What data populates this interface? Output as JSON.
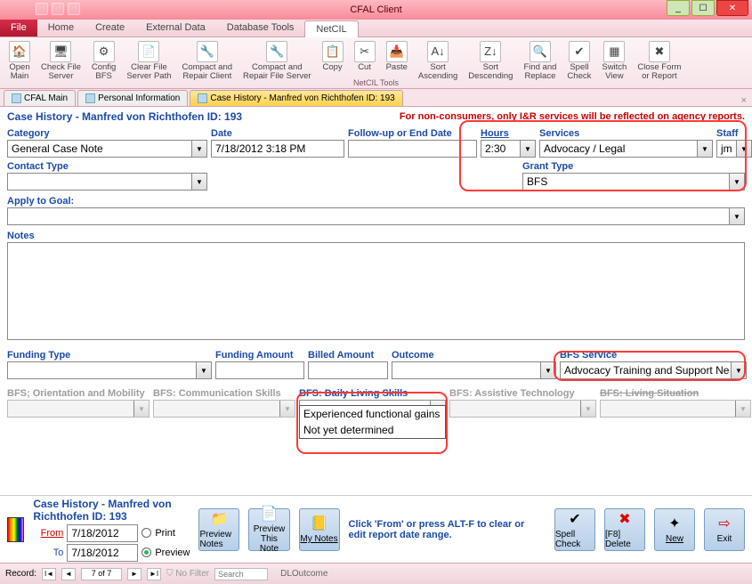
{
  "window": {
    "title": "CFAL Client"
  },
  "menu": {
    "file": "File",
    "tabs": [
      "Home",
      "Create",
      "External Data",
      "Database Tools",
      "NetCIL"
    ],
    "active": 4
  },
  "ribbon": {
    "group_label": "NetCIL Tools",
    "buttons": [
      {
        "label": "Open\nMain",
        "icon": "🏠"
      },
      {
        "label": "Check File\nServer",
        "icon": "🖥"
      },
      {
        "label": "Config\nBFS",
        "icon": "⚙"
      },
      {
        "label": "Clear File\nServer Path",
        "icon": "📄"
      },
      {
        "label": "Compact and\nRepair Client",
        "icon": "🔧"
      },
      {
        "label": "Compact and\nRepair File Server",
        "icon": "🔧"
      },
      {
        "label": "Copy",
        "icon": "📋"
      },
      {
        "label": "Cut",
        "icon": "✂"
      },
      {
        "label": "Paste",
        "icon": "📥"
      },
      {
        "label": "Sort\nAscending",
        "icon": "A↓"
      },
      {
        "label": "Sort\nDescending",
        "icon": "Z↓"
      },
      {
        "label": "Find and\nReplace",
        "icon": "🔍"
      },
      {
        "label": "Spell\nCheck",
        "icon": "✔"
      },
      {
        "label": "Switch\nView",
        "icon": "▦"
      },
      {
        "label": "Close Form\nor Report",
        "icon": "✖"
      }
    ]
  },
  "doctabs": {
    "items": [
      {
        "label": "CFAL Main"
      },
      {
        "label": "Personal Information"
      },
      {
        "label": "Case History  - Manfred von Richthofen ID: 193"
      }
    ],
    "active": 2
  },
  "form": {
    "title": "Case History  - Manfred von Richthofen ID: 193",
    "warning": "For non-consumers, only I&R services will be reflected on agency reports.",
    "labels": {
      "category": "Category",
      "date": "Date",
      "followup": "Follow-up or End Date",
      "hours": "Hours",
      "services": "Services",
      "staff": "Staff",
      "contact_type": "Contact Type",
      "grant_type": "Grant Type",
      "apply_goal": "Apply to Goal:",
      "notes": "Notes",
      "funding_type": "Funding Type",
      "funding_amount": "Funding Amount",
      "billed_amount": "Billed Amount",
      "outcome": "Outcome",
      "bfs_service": "BFS Service",
      "bfs_orient": "BFS; Orientation and Mobility",
      "bfs_comm": "BFS: Communication Skills",
      "bfs_daily": "BFS: Daily Living Skills",
      "bfs_assist": "BFS: Assistive Technology",
      "bfs_living": "BFS: Living Situation"
    },
    "values": {
      "category": "General Case Note",
      "date": "7/18/2012 3:18 PM",
      "followup": "",
      "hours": "2:30",
      "services": "Advocacy / Legal",
      "staff": "jm",
      "contact_type": "",
      "grant_type": "BFS",
      "apply_goal": "",
      "notes": "",
      "funding_type": "",
      "funding_amount": "",
      "billed_amount": "",
      "outcome": "",
      "bfs_service": "Advocacy Training and Support Ne",
      "bfs_daily_input": ""
    },
    "bfs_daily_options": [
      "Experienced functional gains",
      "Not yet determined"
    ]
  },
  "footer": {
    "title": "Case History  - Manfred von Richthofen ID: 193",
    "hint": "Click 'From' or press ALT-F to clear or edit report date range.",
    "from_label": "From",
    "to_label": "To",
    "from": "7/18/2012",
    "to": "7/18/2012",
    "print": "Print",
    "preview": "Preview",
    "buttons": {
      "preview_notes": "Preview Notes",
      "preview_this": "Preview This\nNote",
      "my_notes": "My Notes",
      "spell": "Spell Check",
      "delete": "[F8] Delete",
      "new": "New",
      "exit": "Exit"
    }
  },
  "status": {
    "record_label": "Record:",
    "position": "7 of 7",
    "nofilter": "No Filter",
    "search": "Search",
    "field": "DLOutcome"
  }
}
